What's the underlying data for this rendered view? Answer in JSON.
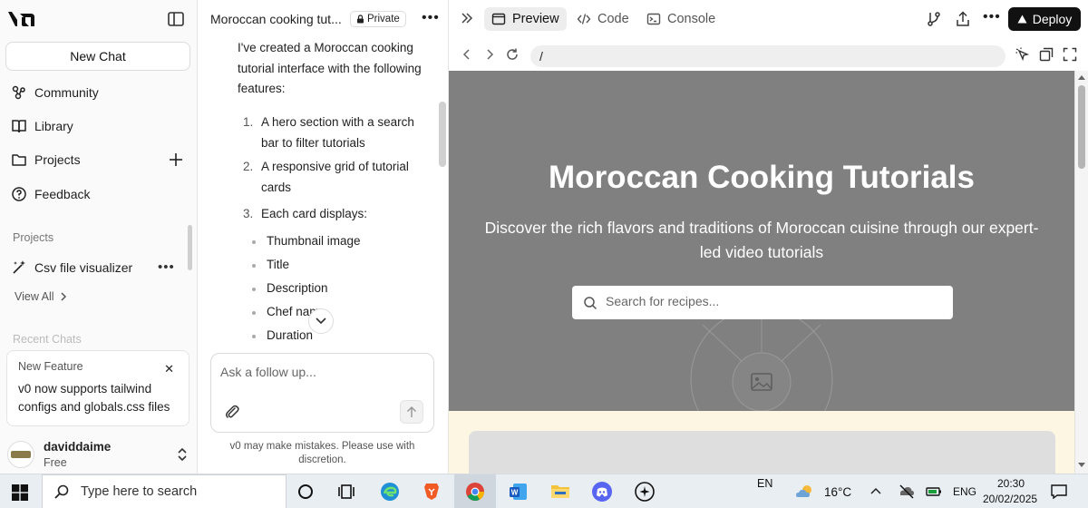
{
  "sidebar": {
    "new_chat": "New Chat",
    "nav": [
      "Community",
      "Library",
      "Projects",
      "Feedback"
    ],
    "projects_label": "Projects",
    "project_item": "Csv file visualizer",
    "view_all": "View All",
    "recent_label": "Recent Chats",
    "feature": {
      "title": "New Feature",
      "body": "v0 now supports tailwind configs and globals.css files"
    },
    "user": {
      "name": "daviddaime",
      "plan": "Free"
    }
  },
  "chat": {
    "title": "Moroccan cooking tut...",
    "badge": "Private",
    "message_intro": "I've created a Moroccan cooking tutorial interface with the following features:",
    "list": [
      {
        "num": "1.",
        "text": "A hero section with a search bar to filter tutorials"
      },
      {
        "num": "2.",
        "text": "A responsive grid of tutorial cards"
      },
      {
        "num": "3.",
        "text": "Each card displays:"
      }
    ],
    "bullets": [
      "Thumbnail image",
      "Title",
      "Description",
      "Chef name",
      "Duration"
    ],
    "composer_placeholder": "Ask a follow up...",
    "disclaimer": "v0 may make mistakes. Please use with discretion."
  },
  "preview": {
    "tabs": [
      "Preview",
      "Code",
      "Console"
    ],
    "deploy": "Deploy",
    "url": "/",
    "site": {
      "title": "Moroccan Cooking Tutorials",
      "subtitle": "Discover the rich flavors and traditions of Moroccan cuisine through our expert-led video tutorials",
      "search_placeholder": "Search for recipes..."
    }
  },
  "taskbar": {
    "search_placeholder": "Type here to search",
    "lang_top": "EN",
    "temperature": "16°C",
    "lang": "ENG",
    "time": "20:30",
    "date": "20/02/2025"
  },
  "colors": {
    "hero_bg": "#808080",
    "cards_bg": "#fdf6e3",
    "deploy_bg": "#111111"
  }
}
